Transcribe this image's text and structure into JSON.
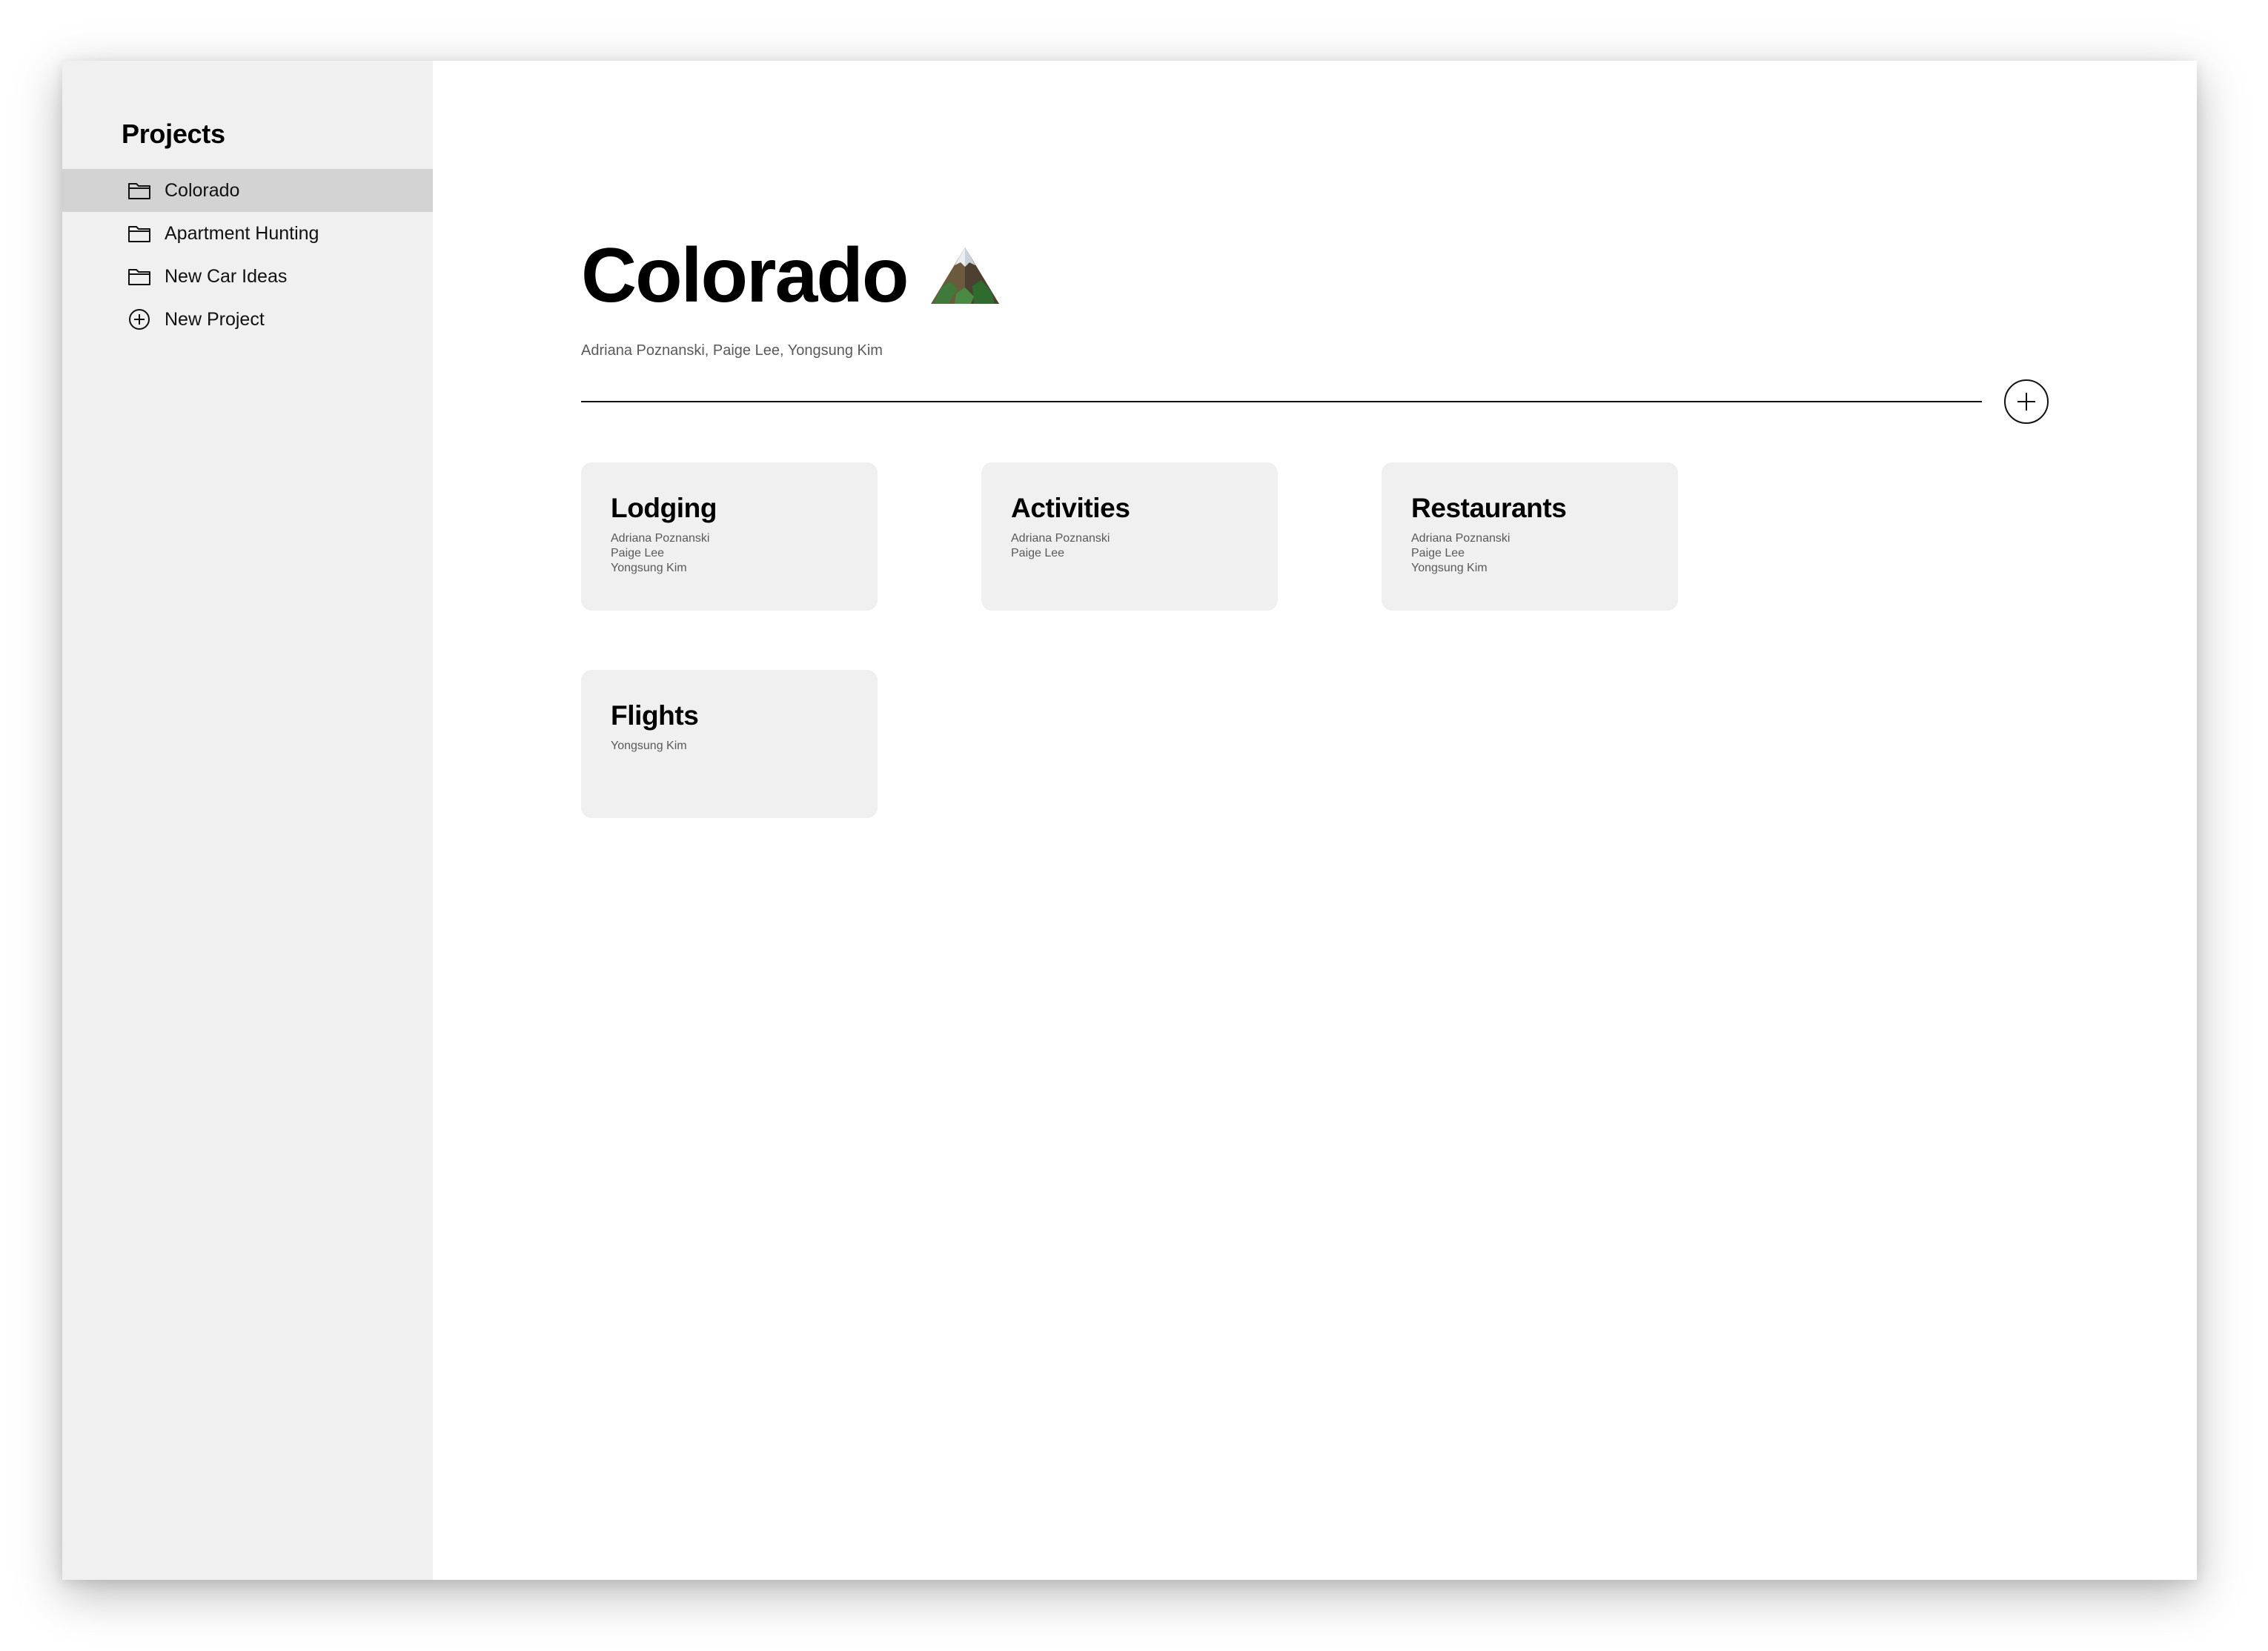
{
  "sidebar": {
    "title": "Projects",
    "items": [
      {
        "label": "Colorado",
        "icon": "folder-icon",
        "selected": true
      },
      {
        "label": "Apartment Hunting",
        "icon": "folder-icon",
        "selected": false
      },
      {
        "label": "New Car Ideas",
        "icon": "folder-icon",
        "selected": false
      },
      {
        "label": "New Project",
        "icon": "plus-circle-icon",
        "selected": false
      }
    ]
  },
  "main": {
    "title": "Colorado",
    "title_icon": "mountain-emoji-icon",
    "collaborators": "Adriana Poznanski, Paige Lee, Yongsung Kim",
    "add_button_icon": "plus-icon",
    "cards": [
      {
        "title": "Lodging",
        "members": [
          "Adriana Poznanski",
          "Paige Lee",
          "Yongsung Kim"
        ]
      },
      {
        "title": "Activities",
        "members": [
          "Adriana Poznanski",
          "Paige Lee"
        ]
      },
      {
        "title": "Restaurants",
        "members": [
          "Adriana Poznanski",
          "Paige Lee",
          "Yongsung Kim"
        ]
      },
      {
        "title": "Flights",
        "members": [
          "Yongsung Kim"
        ]
      }
    ]
  },
  "colors": {
    "sidebar_bg": "#f0f0f0",
    "selected_bg": "#d3d3d3",
    "card_bg": "#f0f0f0",
    "muted_text": "#5a5a5a"
  }
}
